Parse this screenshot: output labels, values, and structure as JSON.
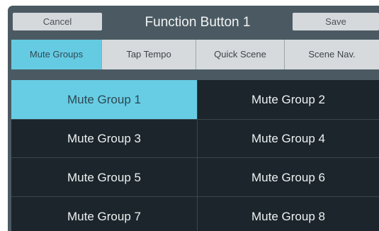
{
  "header": {
    "cancel_label": "Cancel",
    "title": "Function Button 1",
    "save_label": "Save"
  },
  "tabs": [
    {
      "label": "Mute Groups",
      "active": true
    },
    {
      "label": "Tap Tempo",
      "active": false
    },
    {
      "label": "Quick Scene",
      "active": false
    },
    {
      "label": "Scene Nav.",
      "active": false
    }
  ],
  "mute_groups": [
    {
      "label": "Mute Group 1",
      "selected": true
    },
    {
      "label": "Mute Group 2",
      "selected": false
    },
    {
      "label": "Mute Group 3",
      "selected": false
    },
    {
      "label": "Mute Group 4",
      "selected": false
    },
    {
      "label": "Mute Group 5",
      "selected": false
    },
    {
      "label": "Mute Group 6",
      "selected": false
    },
    {
      "label": "Mute Group 7",
      "selected": false
    },
    {
      "label": "Mute Group 8",
      "selected": false
    }
  ],
  "colors": {
    "panel_background": "#4b5a62",
    "accent_selected": "#67cde4",
    "grid_background": "#1b252b",
    "button_light": "#d6d9dc"
  }
}
